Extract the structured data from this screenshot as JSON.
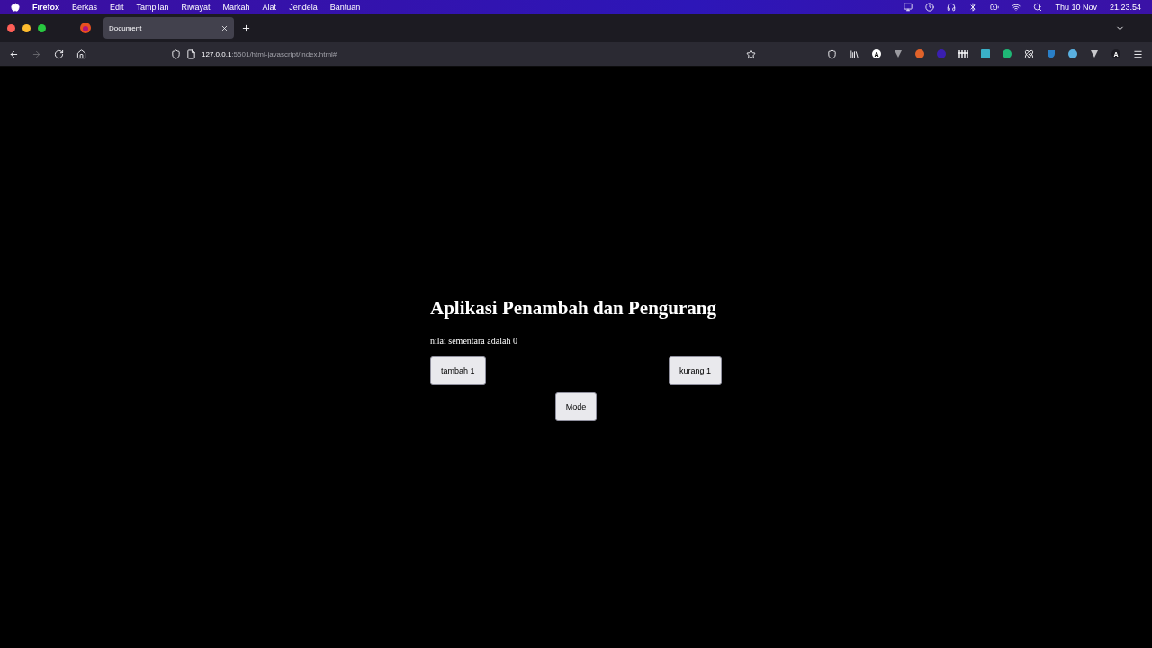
{
  "menu_bar": {
    "app": "Firefox",
    "items": [
      "Berkas",
      "Edit",
      "Tampilan",
      "Riwayat",
      "Markah",
      "Alat",
      "Jendela",
      "Bantuan"
    ],
    "date": "Thu 10 Nov",
    "time": "21.23.54"
  },
  "tabs": [
    {
      "label": "Document",
      "selected": true
    }
  ],
  "address_bar": {
    "host": "127.0.0.1",
    "path": ":5501/html-javascript/index.html#"
  },
  "extensions": [
    {
      "kind": "pocket"
    },
    {
      "kind": "library"
    },
    {
      "kind": "letter",
      "label": "A",
      "color": "#ffffff"
    },
    {
      "kind": "vee",
      "color": "#9a9aa0"
    },
    {
      "kind": "dot",
      "color": "#e0622a"
    },
    {
      "kind": "dot",
      "color": "#3a1fb0"
    },
    {
      "kind": "bars"
    },
    {
      "kind": "square",
      "color": "#3ab0c8"
    },
    {
      "kind": "dot",
      "color": "#1fb876"
    },
    {
      "kind": "atom"
    },
    {
      "kind": "shield",
      "color": "#2a7fc8"
    },
    {
      "kind": "dot",
      "color": "#5ab0e0"
    },
    {
      "kind": "vee",
      "color": "#c8c8cc"
    },
    {
      "kind": "letter",
      "label": "A",
      "color": "#1c1b22"
    }
  ],
  "page": {
    "heading": "Aplikasi Penambah dan Pengurang",
    "status": "nilai sementara adalah 0",
    "buttons": [
      "tambah 1",
      "kurang 1"
    ],
    "mode_button": "Mode"
  }
}
